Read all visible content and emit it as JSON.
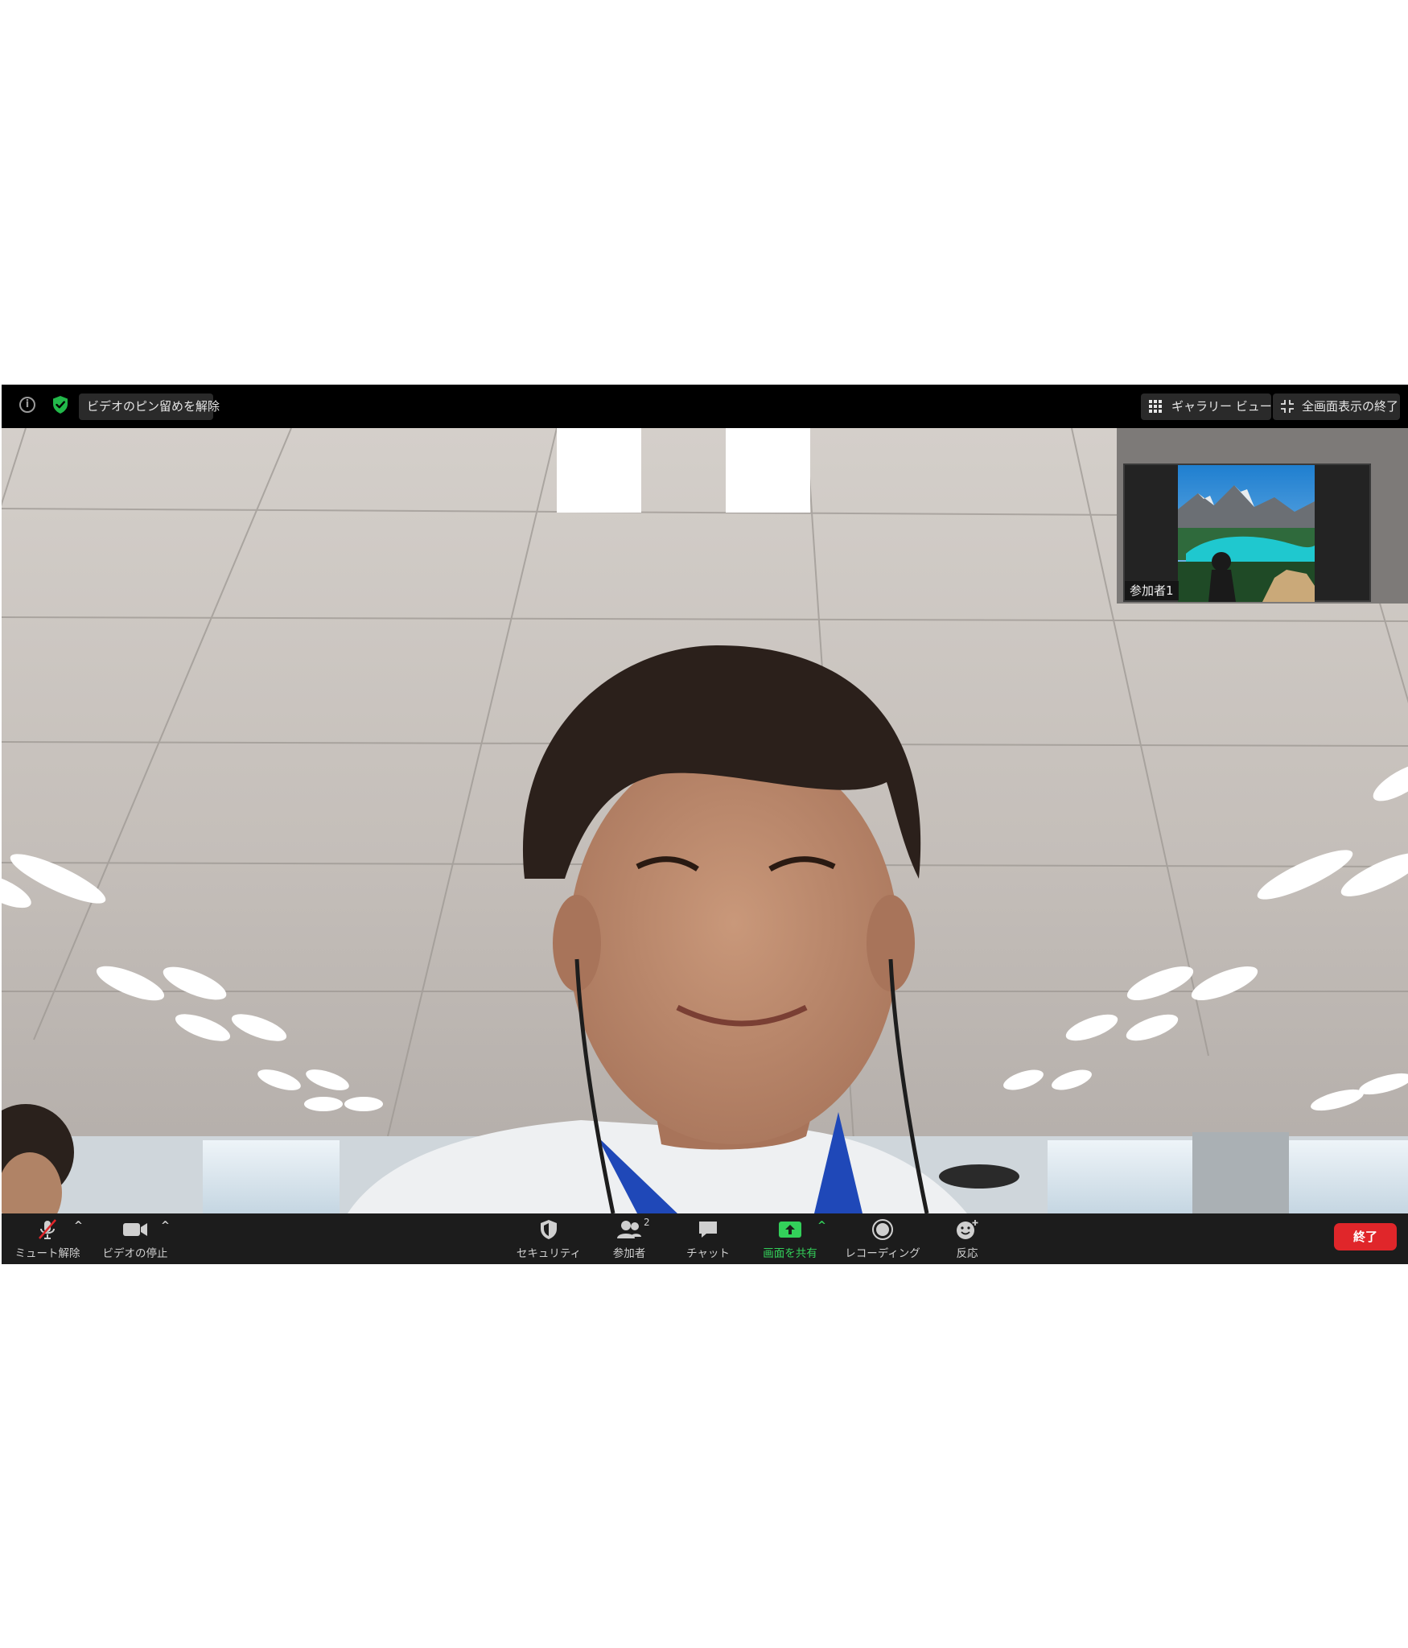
{
  "top_bar": {
    "unpin_label": "ビデオのピン留めを解除",
    "gallery_view_label": "ギャラリー ビュー",
    "exit_fullscreen_label": "全画面表示の終了"
  },
  "thumbnail": {
    "participant_name": "参加者1"
  },
  "toolbar": {
    "mute_label": "ミュート解除",
    "video_label": "ビデオの停止",
    "security_label": "セキュリティ",
    "participants_label": "参加者",
    "participants_count": "2",
    "chat_label": "チャット",
    "share_label": "画面を共有",
    "record_label": "レコーディング",
    "reactions_label": "反応",
    "end_label": "終了"
  },
  "colors": {
    "share_green": "#33d05a",
    "end_red": "#e0262a",
    "toolbar_bg": "#1c1c1c"
  }
}
